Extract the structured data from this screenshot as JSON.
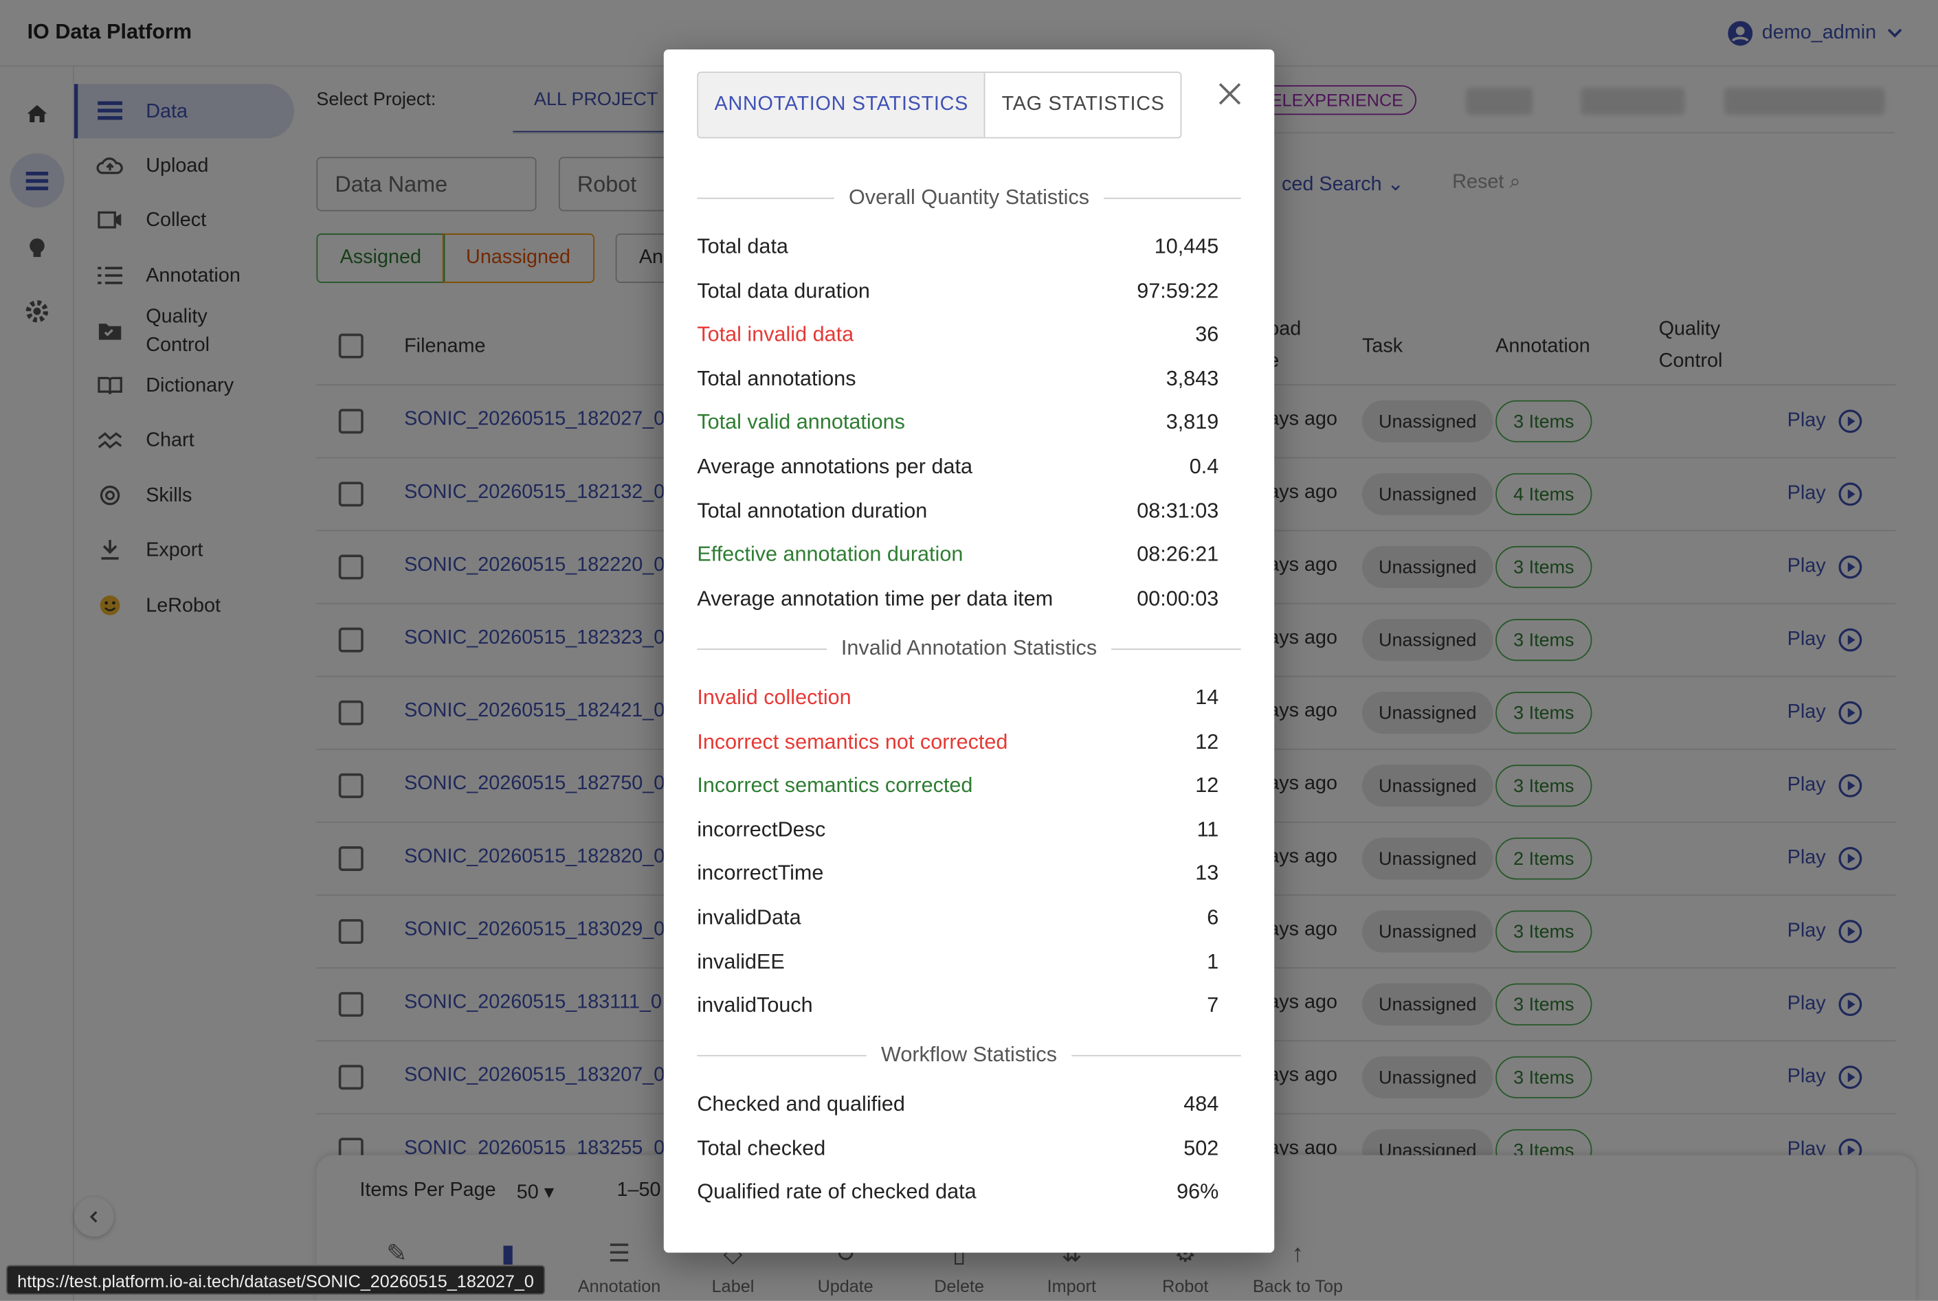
{
  "app": {
    "title": "IO Data Platform",
    "user": "demo_admin"
  },
  "sidebar": {
    "items": [
      {
        "label": "Data",
        "icon": "list-icon"
      },
      {
        "label": "Upload",
        "icon": "cloud-upload-icon"
      },
      {
        "label": "Collect",
        "icon": "video-icon"
      },
      {
        "label": "Annotation",
        "icon": "list-numbered-icon"
      },
      {
        "label": "Quality\nControl",
        "icon": "check-folder-icon"
      },
      {
        "label": "Dictionary",
        "icon": "book-icon"
      },
      {
        "label": "Chart",
        "icon": "chart-line-icon"
      },
      {
        "label": "Skills",
        "icon": "skills-icon"
      },
      {
        "label": "Export",
        "icon": "download-icon"
      },
      {
        "label": "LeRobot",
        "icon": "emoji-icon"
      }
    ]
  },
  "project": {
    "label": "Select Project:",
    "tab": "ALL PROJECT",
    "chip": "ELEXPERIENCE"
  },
  "filters": {
    "data_name": "Data Name",
    "robot": "Robot",
    "advanced": "ced Search",
    "reset": "Reset",
    "assigned": "Assigned",
    "unassigned": "Unassigned",
    "annotation_partial": "An"
  },
  "table": {
    "headers": {
      "filename": "Filename",
      "upload_line1": "oad",
      "upload_line2": "e",
      "task": "Task",
      "annotation": "Annotation",
      "qc_line1": "Quality",
      "qc_line2": "Control"
    },
    "rows": [
      {
        "filename": "SONIC_20260515_182027_0",
        "ago": "ays ago",
        "task": "Unassigned",
        "annotation": "3 Items",
        "action": "Play"
      },
      {
        "filename": "SONIC_20260515_182132_0",
        "ago": "ays ago",
        "task": "Unassigned",
        "annotation": "4 Items",
        "action": "Play"
      },
      {
        "filename": "SONIC_20260515_182220_0",
        "ago": "ays ago",
        "task": "Unassigned",
        "annotation": "3 Items",
        "action": "Play"
      },
      {
        "filename": "SONIC_20260515_182323_0",
        "ago": "ays ago",
        "task": "Unassigned",
        "annotation": "3 Items",
        "action": "Play"
      },
      {
        "filename": "SONIC_20260515_182421_0",
        "ago": "ays ago",
        "task": "Unassigned",
        "annotation": "3 Items",
        "action": "Play"
      },
      {
        "filename": "SONIC_20260515_182750_0",
        "ago": "ays ago",
        "task": "Unassigned",
        "annotation": "3 Items",
        "action": "Play"
      },
      {
        "filename": "SONIC_20260515_182820_0",
        "ago": "ays ago",
        "task": "Unassigned",
        "annotation": "2 Items",
        "action": "Play"
      },
      {
        "filename": "SONIC_20260515_183029_0",
        "ago": "ays ago",
        "task": "Unassigned",
        "annotation": "3 Items",
        "action": "Play"
      },
      {
        "filename": "SONIC_20260515_183111_0",
        "ago": "ays ago",
        "task": "Unassigned",
        "annotation": "3 Items",
        "action": "Play"
      },
      {
        "filename": "SONIC_20260515_183207_0",
        "ago": "ays ago",
        "task": "Unassigned",
        "annotation": "3 Items",
        "action": "Play"
      },
      {
        "filename": "SONIC_20260515_183255_0",
        "ago": "ays ago",
        "task": "Unassigned",
        "annotation": "3 Items",
        "action": "Play"
      }
    ]
  },
  "pagination": {
    "items_per_page_label": "Items Per Page",
    "items_per_page": "50",
    "range": "1–50"
  },
  "toolbar": {
    "items": [
      {
        "label": "",
        "icon": "edit-icon"
      },
      {
        "label": "",
        "icon": "bar-chart-icon"
      },
      {
        "label": "Annotation",
        "icon": "list-numbered-icon"
      },
      {
        "label": "Label",
        "icon": "label-icon"
      },
      {
        "label": "Update",
        "icon": "refresh-icon"
      },
      {
        "label": "Delete",
        "icon": "delete-icon"
      },
      {
        "label": "Import",
        "icon": "import-icon"
      },
      {
        "label": "Robot",
        "icon": "robot-icon"
      },
      {
        "label": "Back to Top",
        "icon": "arrow-up-icon"
      }
    ]
  },
  "status_url": "https://test.platform.io-ai.tech/dataset/SONIC_20260515_182027_0",
  "modal": {
    "tabs": [
      "ANNOTATION STATISTICS",
      "TAG STATISTICS"
    ],
    "sections": [
      {
        "title": "Overall Quantity Statistics",
        "rows": [
          {
            "label": "Total data",
            "value": "10,445",
            "tone": ""
          },
          {
            "label": "Total data duration",
            "value": "97:59:22",
            "tone": ""
          },
          {
            "label": "Total invalid data",
            "value": "36",
            "tone": "red"
          },
          {
            "label": "Total annotations",
            "value": "3,843",
            "tone": ""
          },
          {
            "label": "Total valid annotations",
            "value": "3,819",
            "tone": "green"
          },
          {
            "label": "Average annotations per data",
            "value": "0.4",
            "tone": ""
          },
          {
            "label": "Total annotation duration",
            "value": "08:31:03",
            "tone": ""
          },
          {
            "label": "Effective annotation duration",
            "value": "08:26:21",
            "tone": "green"
          },
          {
            "label": "Average annotation time per data item",
            "value": "00:00:03",
            "tone": ""
          }
        ]
      },
      {
        "title": "Invalid Annotation Statistics",
        "rows": [
          {
            "label": "Invalid collection",
            "value": "14",
            "tone": "red"
          },
          {
            "label": "Incorrect semantics not corrected",
            "value": "12",
            "tone": "red"
          },
          {
            "label": "Incorrect semantics corrected",
            "value": "12",
            "tone": "green"
          },
          {
            "label": "incorrectDesc",
            "value": "11",
            "tone": ""
          },
          {
            "label": "incorrectTime",
            "value": "13",
            "tone": ""
          },
          {
            "label": "invalidData",
            "value": "6",
            "tone": ""
          },
          {
            "label": "invalidEE",
            "value": "1",
            "tone": ""
          },
          {
            "label": "invalidTouch",
            "value": "7",
            "tone": ""
          }
        ]
      },
      {
        "title": "Workflow Statistics",
        "rows": [
          {
            "label": "Checked and qualified",
            "value": "484",
            "tone": ""
          },
          {
            "label": "Total checked",
            "value": "502",
            "tone": ""
          },
          {
            "label": "Qualified rate of checked data",
            "value": "96%",
            "tone": ""
          }
        ]
      }
    ]
  },
  "colors": {
    "primary": "#3f51b5",
    "invalid": "#e53935",
    "valid": "#2e7d32"
  }
}
